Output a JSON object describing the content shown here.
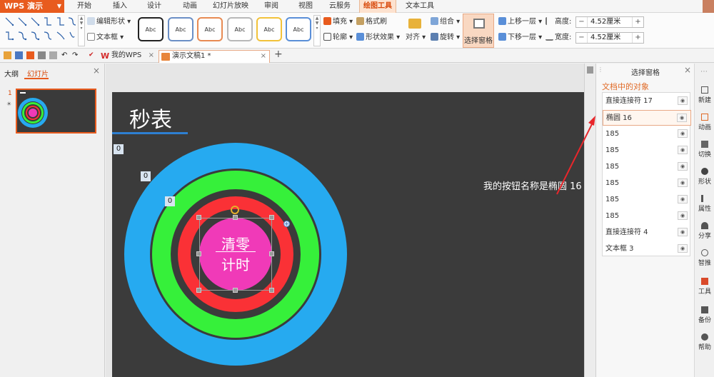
{
  "app": {
    "name": "WPS 演示",
    "brand_color": "#e85b1e"
  },
  "menu": {
    "tabs": [
      {
        "label": "开始"
      },
      {
        "label": "插入"
      },
      {
        "label": "设计"
      },
      {
        "label": "动画"
      },
      {
        "label": "幻灯片放映"
      },
      {
        "label": "审阅"
      },
      {
        "label": "视图"
      },
      {
        "label": "云服务"
      },
      {
        "label": "绘图工具"
      },
      {
        "label": "文本工具"
      }
    ],
    "active": "绘图工具"
  },
  "ribbon": {
    "edit_shape": "编辑形状",
    "text_box": "文本框",
    "style_sample": "Abc",
    "fill": "填充",
    "format_painter": "格式刷",
    "outline": "轮廓",
    "shape_effects": "形状效果",
    "align": "对齐",
    "group": "组合",
    "rotate": "旋转",
    "selection_pane": "选择窗格",
    "bring_forward": "上移一层",
    "send_backward": "下移一层",
    "height_label": "高度:",
    "height_value": "4.52厘米",
    "width_label": "宽度:",
    "width_value": "4.52厘米",
    "minus": "−",
    "plus": "+"
  },
  "docbar": {
    "tabs": [
      {
        "label": "我的WPS",
        "close": "×"
      },
      {
        "label": "演示文稿1 *",
        "close": "×"
      }
    ],
    "new_tab": "+"
  },
  "left_panel": {
    "tab_outline": "大纲",
    "tab_slides": "幻灯片",
    "close": "×",
    "slide_number": "1",
    "slide_marker": "☀"
  },
  "slide": {
    "title": "秒表",
    "counter_outer": "0",
    "counter_middle": "0",
    "counter_inner": "0",
    "button_line1": "清零",
    "button_line2": "计时",
    "annotation": "我的按钮名称是椭圆 16",
    "colors": {
      "background": "#3b3b3b",
      "ring_outer": "#26aaf0",
      "ring_middle": "#36f03a",
      "ring_inner": "#fa3136",
      "button": "#f03ab8",
      "arrow": "#e8262b"
    }
  },
  "selection_pane": {
    "title": "选择窗格",
    "close": "×",
    "heading": "文档中的对象",
    "eye_icon": "◉",
    "objects": [
      {
        "name": "直接连接符 17",
        "selected": false
      },
      {
        "name": "椭圆 16",
        "selected": true
      },
      {
        "name": "185",
        "selected": false
      },
      {
        "name": "185",
        "selected": false
      },
      {
        "name": "185",
        "selected": false
      },
      {
        "name": "185",
        "selected": false
      },
      {
        "name": "185",
        "selected": false
      },
      {
        "name": "185",
        "selected": false
      },
      {
        "name": "直接连接符 4",
        "selected": false
      },
      {
        "name": "文本框 3",
        "selected": false
      }
    ]
  },
  "right_bar": {
    "items": [
      {
        "label": "新建",
        "icon": "new-icon"
      },
      {
        "label": "动画",
        "icon": "animation-icon"
      },
      {
        "label": "切换",
        "icon": "transition-icon"
      },
      {
        "label": "形状",
        "icon": "shape-icon"
      },
      {
        "label": "属性",
        "icon": "property-icon"
      },
      {
        "label": "分享",
        "icon": "share-icon"
      },
      {
        "label": "智推",
        "icon": "bulb-icon"
      },
      {
        "label": "工具",
        "icon": "toolbox-icon"
      },
      {
        "label": "备份",
        "icon": "backup-icon"
      },
      {
        "label": "帮助",
        "icon": "help-icon"
      }
    ]
  }
}
